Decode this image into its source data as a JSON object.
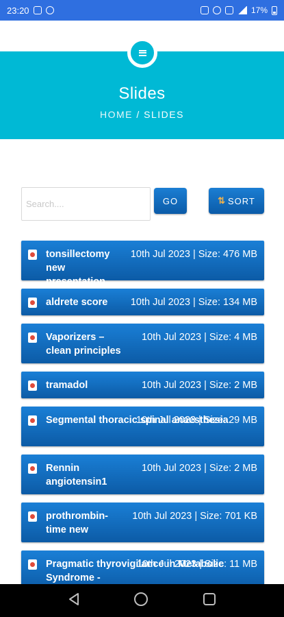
{
  "status_bar": {
    "time": "23:20",
    "battery": "17%"
  },
  "hero": {
    "title": "Slides",
    "breadcrumb_home": "HOME",
    "breadcrumb_sep": "/",
    "breadcrumb_current": "SLIDES"
  },
  "search": {
    "placeholder": "Search....",
    "go_label": "GO",
    "sort_label": "SORT"
  },
  "slides": [
    {
      "title": "tonsillectomy new presentation",
      "meta": "10th Jul 2023 | Size: 476 MB"
    },
    {
      "title": "aldrete score",
      "meta": "10th Jul 2023 | Size: 134 MB"
    },
    {
      "title": "Vaporizers – clean principles",
      "meta": "10th Jul 2023 | Size: 4 MB"
    },
    {
      "title": "tramadol",
      "meta": "10th Jul 2023 | Size: 2 MB"
    },
    {
      "title": "Segmental thoracic spinal anaesthesia",
      "meta": "10th Jul 2023 | Size: 29 MB"
    },
    {
      "title": "Rennin angiotensin1",
      "meta": "10th Jul 2023 | Size: 2 MB"
    },
    {
      "title": "prothrombin-time new",
      "meta": "10th Jul 2023 | Size: 701 KB"
    },
    {
      "title": "Pragmatic thyrovigilance in Metabolic Syndrome -",
      "meta": "10th Jul 2023 | Size: 11 MB"
    }
  ],
  "colors": {
    "status_bar": "#2f6fe0",
    "hero": "#00b9d5",
    "button": "#1071c4",
    "nav_bar": "#000000"
  }
}
